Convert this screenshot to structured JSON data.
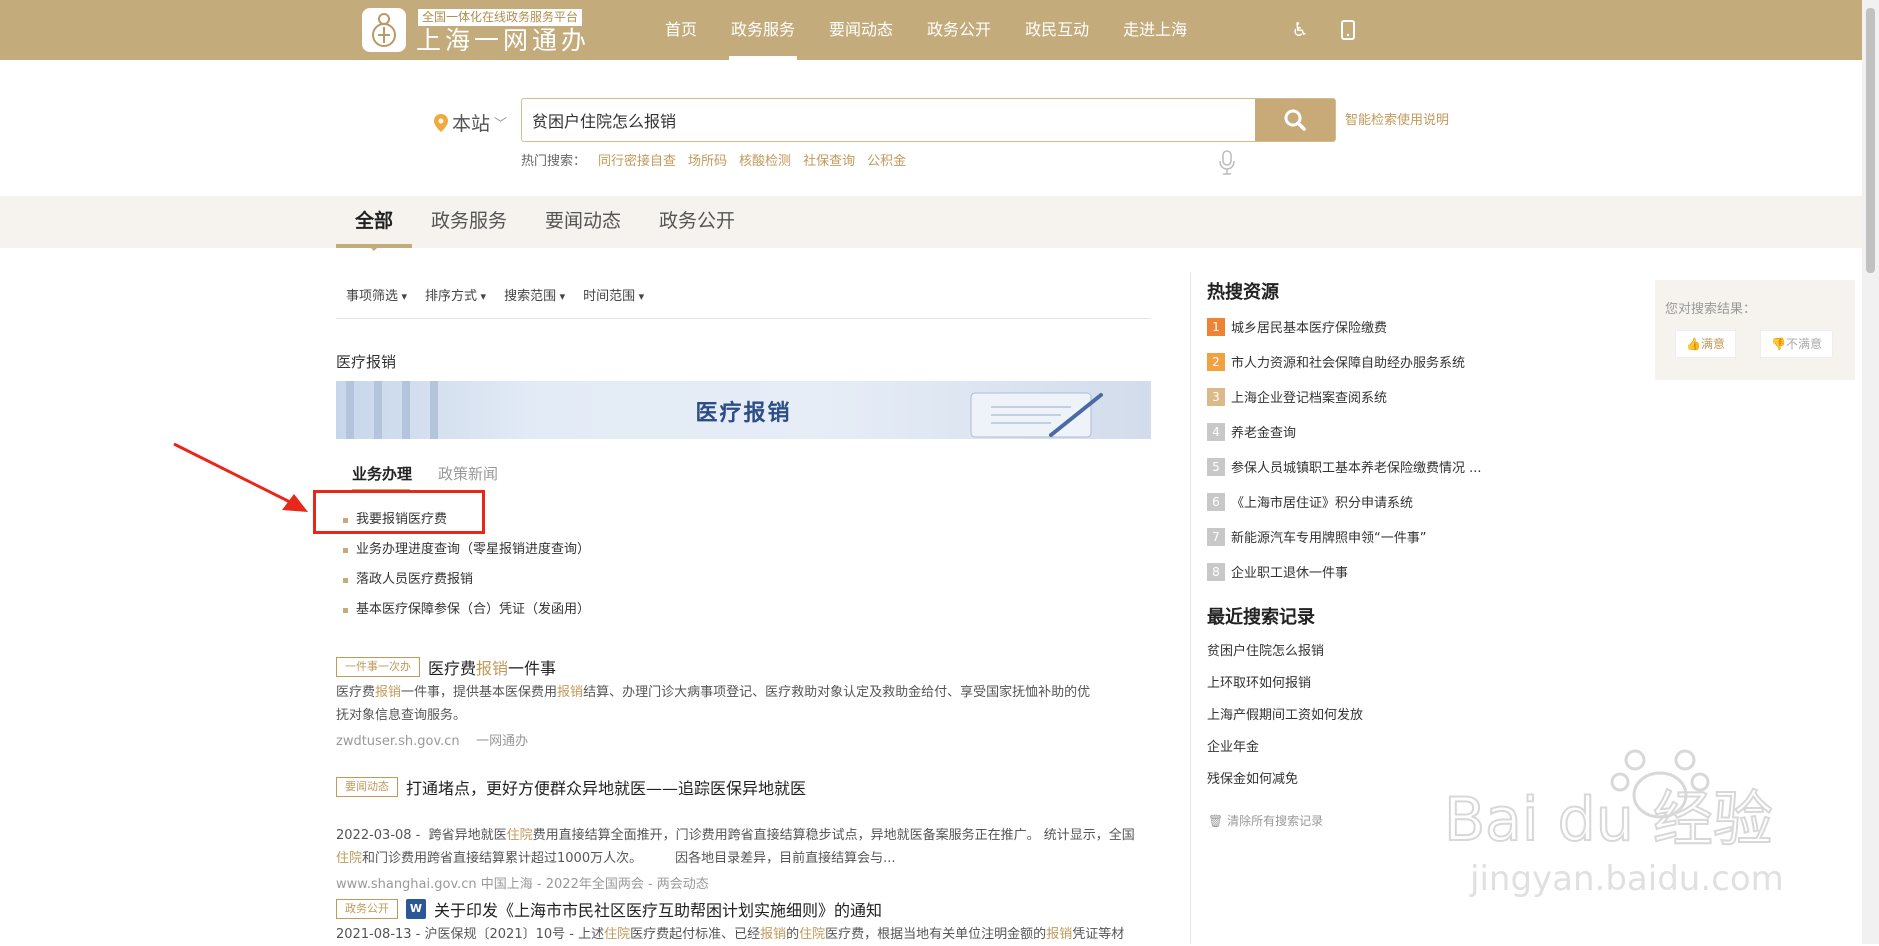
{
  "header": {
    "platform_tag": "全国一体化在线政务服务平台",
    "brand_name": "上海一网通办",
    "nav": [
      "首页",
      "政务服务",
      "要闻动态",
      "政务公开",
      "政民互动",
      "走进上海"
    ],
    "active_nav_index": 1,
    "icons": [
      "accessibility-icon",
      "mobile-icon"
    ]
  },
  "search": {
    "site_selector": "本站",
    "query": "贫困户住院怎么报销",
    "help_link": "智能检索使用说明",
    "hot_label": "热门搜索：",
    "hot_keywords": [
      "同行密接自查",
      "场所码",
      "核酸检测",
      "社保查询",
      "公积金"
    ]
  },
  "tabs": [
    "全部",
    "政务服务",
    "要闻动态",
    "政务公开"
  ],
  "filters": [
    "事项筛选",
    "排序方式",
    "搜索范围",
    "时间范围"
  ],
  "section": {
    "title": "医疗报销",
    "banner_text": "医疗报销",
    "subtabs": [
      "业务办理",
      "政策新闻"
    ],
    "items": [
      "我要报销医疗费",
      "业务办理进度查询（零星报销进度查询）",
      "落政人员医疗费报销",
      "基本医疗保障参保（合）凭证（发函用）"
    ]
  },
  "results": [
    {
      "tag": "一件事一次办",
      "title_parts": [
        "医疗费",
        "报销",
        "一件事"
      ],
      "desc_line1_parts": [
        "医疗费",
        "报销",
        "一件事，提供基本医保费用",
        "报销",
        "结算、办理门诊大病事项登记、医疗救助对象认定及救助金给付、享受国家抚恤补助的优"
      ],
      "desc_line2": "抚对象信息查询服务。",
      "source": "zwdtuser.sh.gov.cn    一网通办"
    },
    {
      "tag": "要闻动态",
      "title": "打通堵点，更好方便群众异地就医——追踪医保异地就医",
      "desc_line1_parts": [
        "2022-03-08 -  跨省异地就医",
        "住院",
        "费用直接结算全面推开，门诊费用跨省直接结算稳步试点，异地就医备案服务正在推广。 统计显示，全国"
      ],
      "desc_line2_parts": [
        "住院",
        "和门诊费用跨省直接结算累计超过1000万人次。        因各地目录差异，目前直接结算会与..."
      ],
      "source": "www.shanghai.gov.cn  中国上海 - 2022年全国两会 - 两会动态"
    },
    {
      "tag": "政务公开",
      "word_badge": "W",
      "title": "关于印发《上海市市民社区医疗互助帮困计划实施细则》的通知",
      "desc_parts": [
        "2021-08-13 -  沪医保规〔2021〕10号 - 上述",
        "住院",
        "医疗费起付标准、已经",
        "报销",
        "的",
        "住院",
        "医疗费，根据当地有关单位注明金额的",
        "报销",
        "凭证等材"
      ]
    }
  ],
  "sidebar": {
    "hot_title": "热搜资源",
    "hot_items": [
      "城乡居民基本医疗保险缴费",
      "市人力资源和社会保障自助经办服务系统",
      "上海企业登记档案查阅系统",
      "养老金查询",
      "参保人员城镇职工基本养老保险缴费情况 ...",
      "《上海市居住证》积分申请系统",
      "新能源汽车专用牌照申领“一件事”",
      "企业职工退休一件事"
    ],
    "recent_title": "最近搜索记录",
    "recent_items": [
      "贫困户住院怎么报销",
      "上环取环如何报销",
      "上海产假期间工资如何发放",
      "企业年金",
      "残保金如何减免"
    ],
    "clear_label": "清除所有搜索记录"
  },
  "feedback": {
    "label": "您对搜索结果：",
    "good": "满意",
    "bad": "不满意"
  },
  "watermark": {
    "brand": "Bai du 经验",
    "url": "jingyan.baidu.com"
  },
  "colors": {
    "brand": "#c4ab7c",
    "highlight": "#c19a5b",
    "annotation": "#e8271b"
  }
}
